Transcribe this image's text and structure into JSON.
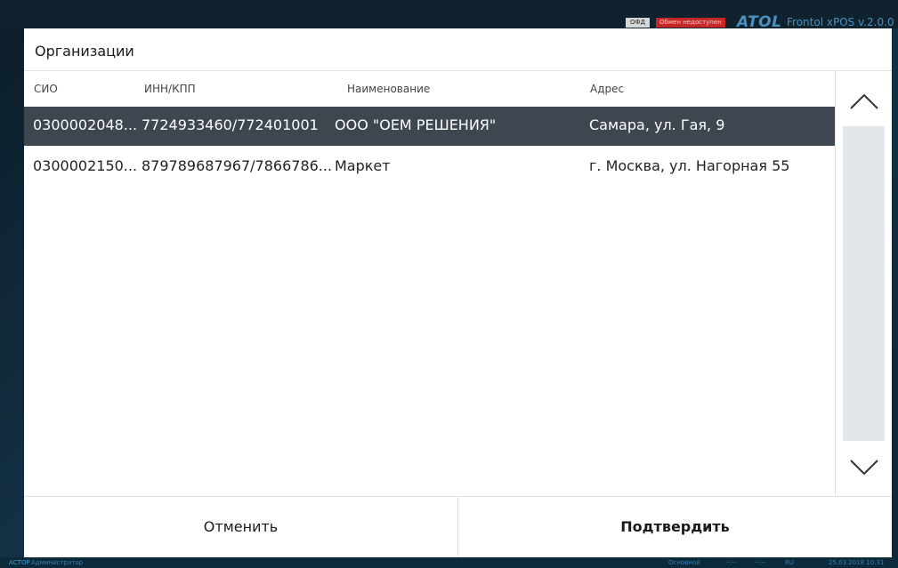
{
  "app": {
    "ofd_badge": "ОФД",
    "exchange_status": "Обмен недоступен",
    "brand": "ATOL",
    "version": "Frontol xPOS v.2.0.0"
  },
  "dialog": {
    "title": "Организации",
    "columns": [
      "СИО",
      "ИНН/КПП",
      "Наименование",
      "Адрес"
    ],
    "rows": [
      {
        "sio": "0300002048...",
        "inn_kpp": "7724933460/772401001",
        "name": "ООО \"ОЕМ РЕШЕНИЯ\"",
        "address": "Самара, ул. Гая, 9",
        "selected": true
      },
      {
        "sio": "0300002150...",
        "inn_kpp": "879789687967/7866786...",
        "name": "Маркет",
        "address": "г. Москва, ул. Нагорная 55",
        "selected": false
      }
    ],
    "cancel_label": "Отменить",
    "confirm_label": "Подтвердить",
    "scroll_up_icon": "chevron-up-icon",
    "scroll_down_icon": "chevron-down-icon"
  },
  "statusbar": {
    "company": "АСТОР",
    "user": "Администратор",
    "mode": "Основной",
    "t1": "--:--",
    "t2": "--:--",
    "lang": "RU",
    "datetime": "25.03.2018 10:31"
  },
  "colors": {
    "selected_row": "#3e4650",
    "accent": "#4a90c2",
    "error_badge": "#c62828"
  }
}
